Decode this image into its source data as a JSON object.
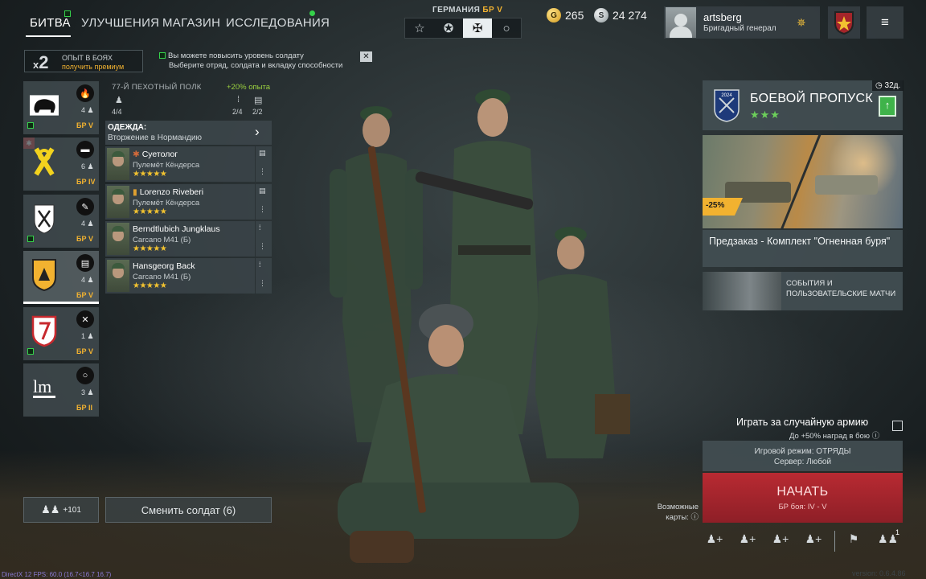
{
  "nav": {
    "tabs": [
      "БИТВА",
      "УЛУЧШЕНИЯ",
      "МАГАЗИН",
      "ИССЛЕДОВАНИЯ"
    ]
  },
  "nation": {
    "label": "ГЕРМАНИЯ",
    "br": "БР V",
    "buttons": [
      "☆",
      "✪",
      "✠",
      "○"
    ]
  },
  "currency": {
    "gold": "265",
    "silver": "24 274"
  },
  "profile": {
    "name": "artsberg",
    "rank": "Бригадный генерал"
  },
  "xp_bonus": {
    "multiplier": "2",
    "title": "ОПЫТ В БОЯХ",
    "link": "получить премиум"
  },
  "hint": {
    "line1": "Вы можете повысить уровень солдату",
    "line2": "Выберите отряд, солдата и вкладку способности"
  },
  "squads": [
    {
      "count": "4",
      "br": "БР V"
    },
    {
      "count": "6",
      "br": "БР IV"
    },
    {
      "count": "4",
      "br": "БР V"
    },
    {
      "count": "4",
      "br": "БР V"
    },
    {
      "count": "1",
      "br": "БР V"
    },
    {
      "count": "3",
      "br": "БР II"
    }
  ],
  "regiment": {
    "title": "77-Й ПЕХОТНЫЙ ПОЛК",
    "xp": "+20% опыта",
    "soldiers_count": "4/4",
    "stat2": "2/4",
    "stat3": "2/2"
  },
  "outfit": {
    "title": "ОДЕЖДА:",
    "value": "Вторжение в Нормандию"
  },
  "soldiers": [
    {
      "name": "Суетолог",
      "weapon": "Пулемёт Кёндерса",
      "stars": "★★★★★"
    },
    {
      "name": "Lorenzo Riveberi",
      "weapon": "Пулемёт Кёндерса",
      "stars": "★★★★★"
    },
    {
      "name": "Berndtlubich Jungklaus",
      "weapon": "Carcano M41 (Б)",
      "stars": "★★★★★"
    },
    {
      "name": "Hansgeorg Back",
      "weapon": "Carcano M41 (Б)",
      "stars": "★★★★★"
    }
  ],
  "bottom_left": {
    "plus": "+101",
    "change": "Сменить солдат (6)"
  },
  "battle_pass": {
    "title": "БОЕВОЙ ПРОПУСК",
    "stars": "★★★",
    "days": "32д.",
    "emblem_year": "2024"
  },
  "promo": {
    "discount": "-25%",
    "text": "Предзаказ - Комплект \"Огненная буря\""
  },
  "events": {
    "text": "СОБЫТИЯ И ПОЛЬЗОВАТЕЛЬСКИЕ МАТЧИ"
  },
  "random_army": {
    "label": "Играть за случайную армию",
    "sub": "До +50% наград в бою"
  },
  "mode": {
    "line1": "Игровой режим: ОТРЯДЫ",
    "line2": "Сервер: Любой"
  },
  "start": {
    "label": "НАЧАТЬ",
    "sub": "БР боя: IV - V"
  },
  "maps": {
    "label": "Возможные карты:"
  },
  "bottom_icons": {
    "friends_count": "1"
  },
  "debug": {
    "text": "DirectX 12 FPS: 60.0 (16.7<16.7 16.7)",
    "version": "version: 0.6.4.86"
  },
  "colors": {
    "accent_gold": "#f2b230",
    "start_red": "#b82a32",
    "ok_green": "#35d14a"
  }
}
